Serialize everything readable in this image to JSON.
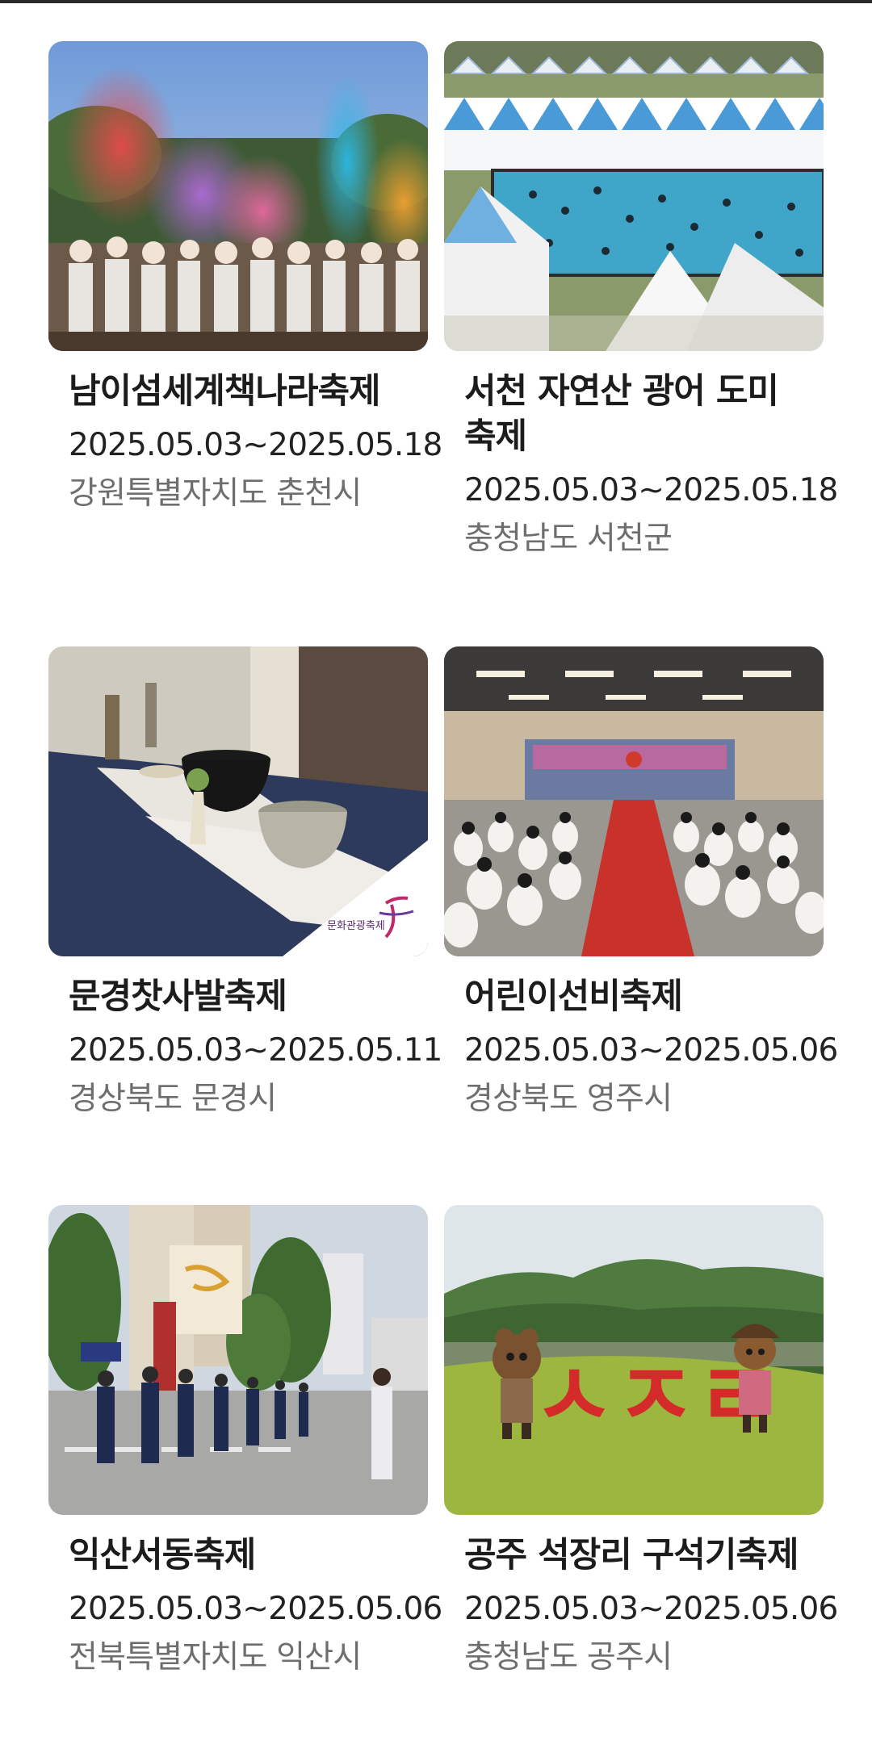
{
  "festivals": [
    {
      "title": "남이섬세계책나라축제",
      "date": "2025.05.03~2025.05.18",
      "location": "강원특별자치도 춘천시",
      "image_icon": "color-powder-crowd-photo"
    },
    {
      "title": "서천 자연산 광어 도미 축제",
      "date": "2025.05.03~2025.05.18",
      "location": "충청남도 서천군",
      "image_icon": "fishing-pool-tents-photo"
    },
    {
      "title": "문경찻사발축제",
      "date": "2025.05.03~2025.05.11",
      "location": "경상북도 문경시",
      "image_icon": "tea-bowls-photo",
      "image_watermark": "문화관광축제"
    },
    {
      "title": "어린이선비축제",
      "date": "2025.05.03~2025.05.06",
      "location": "경상북도 영주시",
      "image_icon": "children-hall-ceremony-photo"
    },
    {
      "title": "익산서동축제",
      "date": "2025.05.03~2025.05.06",
      "location": "전북특별자치도 익산시",
      "image_icon": "street-parade-photo"
    },
    {
      "title": "공주 석장리 구석기축제",
      "date": "2025.05.03~2025.05.06",
      "location": "충청남도 공주시",
      "image_icon": "mascots-hill-sign-photo",
      "image_sign_text": "ㅅㅈㄹ"
    }
  ]
}
